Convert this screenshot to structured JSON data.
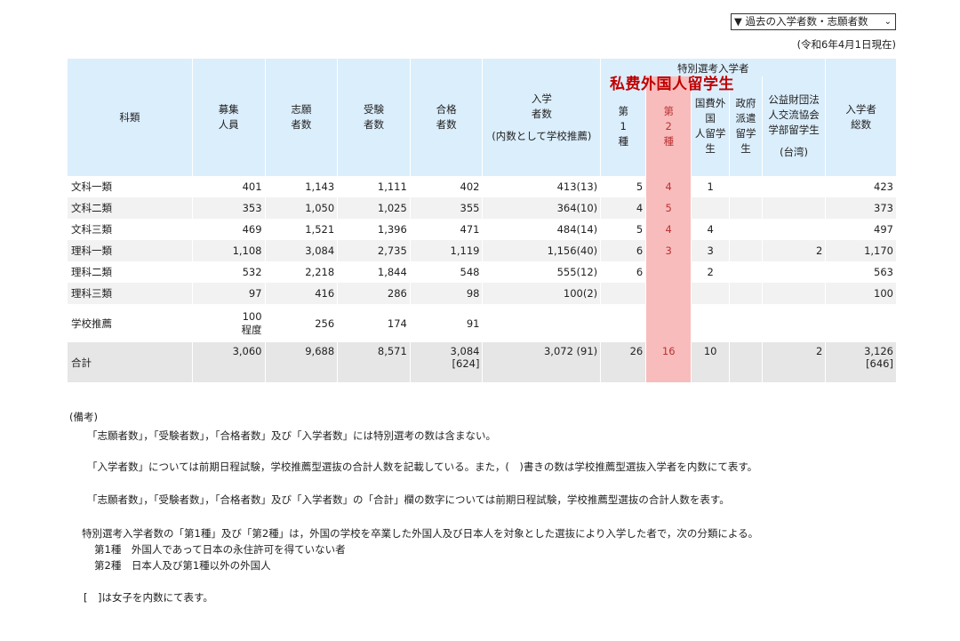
{
  "dropdown": {
    "selected": "▼ 過去の入学者数・志願者数",
    "arrow": "⌄"
  },
  "as_of": "(令和6年4月1日現在)",
  "overlay_label": "私费外国人留学生",
  "headers": {
    "subject": "科類",
    "quota": [
      "募集",
      "人員"
    ],
    "applicants": [
      "志願",
      "者数"
    ],
    "examinees": [
      "受験",
      "者数"
    ],
    "passed": [
      "合格",
      "者数"
    ],
    "enrolled": [
      "入学",
      "者数",
      "(内数として学校推薦)"
    ],
    "special": "特別選考入学者",
    "type1": [
      "第",
      "1",
      "種"
    ],
    "type2": [
      "第",
      "2",
      "種"
    ],
    "govt_intl": [
      "国費外",
      "国",
      "人留学",
      "生"
    ],
    "govt_dispatch": [
      "政府",
      "派遣",
      "留学",
      "生"
    ],
    "foundation": [
      "公益財団法",
      "人交流協会",
      "学部留学生",
      "(台湾)"
    ],
    "total_enrolled": [
      "入学者",
      "総数"
    ]
  },
  "rows": [
    {
      "subject": "文科一類",
      "quota": "401",
      "applicants": "1,143",
      "examinees": "1,111",
      "passed": "402",
      "enrolled": "413(13)",
      "t1": "5",
      "t2": "4",
      "govt": "1",
      "dispatch": "",
      "foundation": "",
      "total": "423"
    },
    {
      "subject": "文科二類",
      "quota": "353",
      "applicants": "1,050",
      "examinees": "1,025",
      "passed": "355",
      "enrolled": "364(10)",
      "t1": "4",
      "t2": "5",
      "govt": "",
      "dispatch": "",
      "foundation": "",
      "total": "373"
    },
    {
      "subject": "文科三類",
      "quota": "469",
      "applicants": "1,521",
      "examinees": "1,396",
      "passed": "471",
      "enrolled": "484(14)",
      "t1": "5",
      "t2": "4",
      "govt": "4",
      "dispatch": "",
      "foundation": "",
      "total": "497"
    },
    {
      "subject": "理科一類",
      "quota": "1,108",
      "applicants": "3,084",
      "examinees": "2,735",
      "passed": "1,119",
      "enrolled": "1,156(40)",
      "t1": "6",
      "t2": "3",
      "govt": "3",
      "dispatch": "",
      "foundation": "2",
      "total": "1,170"
    },
    {
      "subject": "理科二類",
      "quota": "532",
      "applicants": "2,218",
      "examinees": "1,844",
      "passed": "548",
      "enrolled": "555(12)",
      "t1": "6",
      "t2": "",
      "govt": "2",
      "dispatch": "",
      "foundation": "",
      "total": "563"
    },
    {
      "subject": "理科三類",
      "quota": "97",
      "applicants": "416",
      "examinees": "286",
      "passed": "98",
      "enrolled": "100(2)",
      "t1": "",
      "t2": "",
      "govt": "",
      "dispatch": "",
      "foundation": "",
      "total": "100"
    }
  ],
  "school_rec": {
    "subject": "学校推薦",
    "quota1": "100",
    "quota2": "程度",
    "applicants": "256",
    "examinees": "174",
    "passed": "91"
  },
  "total_row": {
    "subject": "合計",
    "quota": "3,060",
    "applicants": "9,688",
    "examinees": "8,571",
    "passed1": "3,084",
    "passed2": "[624]",
    "enrolled": "3,072 (91)",
    "t1": "26",
    "t2": "16",
    "govt": "10",
    "dispatch": "",
    "foundation": "2",
    "total1": "3,126",
    "total2": "[646]"
  },
  "notes": {
    "heading": "(備考)",
    "n1": "「志願者数」，「受験者数」，「合格者数」及び「入学者数」には特別選考の数は含まない。",
    "n2": "「入学者数」については前期日程試験，学校推薦型選抜の合計人数を記載している。また，(　)書きの数は学校推薦型選抜入学者を内数にて表す。",
    "n3": "「志願者数」，「受験者数」，「合格者数」及び「入学者数」の「合計」欄の数字については前期日程試験，学校推薦型選抜の合計人数を表す。",
    "n4": "特別選考入学者数の「第1種」及び「第2種」は，外国の学校を卒業した外国人及び日本人を対象とした選抜により入学した者で，次の分類による。",
    "n5": "第1種　外国人であって日本の永住許可を得ていない者",
    "n6": "第2種　日本人及び第1種以外の外国人",
    "n7": "[　]は女子を内数にて表す。"
  }
}
